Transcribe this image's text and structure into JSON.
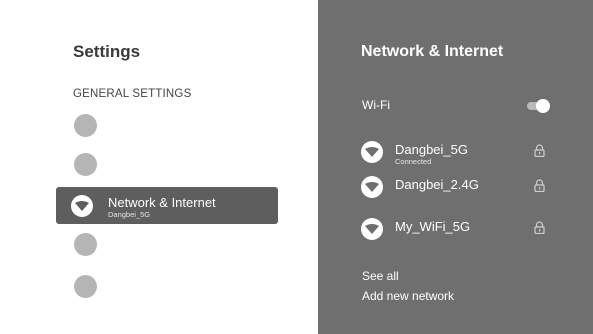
{
  "left": {
    "title": "Settings",
    "section_label": "GENERAL SETTINGS",
    "selected_item": {
      "label": "Network & Internet",
      "sublabel": "Dangbei_5G",
      "icon": "wifi-icon"
    }
  },
  "right": {
    "title": "Network & Internet",
    "wifi_label": "Wi-Fi",
    "wifi_enabled": true,
    "networks": [
      {
        "name": "Dangbei_5G",
        "status": "Connected",
        "icon": "wifi-icon",
        "secured": true
      },
      {
        "name": "Dangbei_2.4G",
        "status": "",
        "icon": "wifi-icon",
        "secured": true
      },
      {
        "name": "My_WiFi_5G",
        "status": "",
        "icon": "wifi-icon",
        "secured": true
      }
    ],
    "see_all": "See all",
    "add_network": "Add new network"
  },
  "colors": {
    "left_bg": "#ffffff",
    "right_bg": "#6f6f6f",
    "selected_bg": "#5e5e5e",
    "placeholder_dot": "#b5b5b5"
  }
}
